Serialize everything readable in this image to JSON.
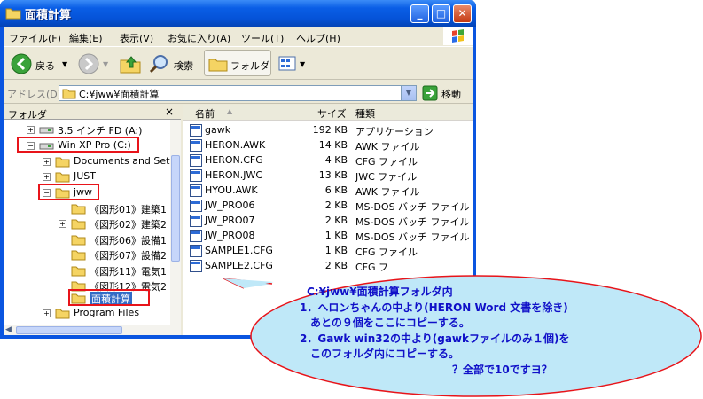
{
  "window": {
    "title": "面積計算",
    "controls": {
      "minimize": "_",
      "maximize": "□",
      "close": "✕"
    }
  },
  "menubar": [
    "ファイル(F)",
    "編集(E)",
    "表示(V)",
    "お気に入り(A)",
    "ツール(T)",
    "ヘルプ(H)"
  ],
  "toolbar": {
    "back": "戻る",
    "search": "検索",
    "folders": "フォルダ"
  },
  "address": {
    "label": "アドレス(D)",
    "value": "C:¥jww¥面積計算",
    "go": "移動"
  },
  "folder_pane": {
    "title": "フォルダ",
    "close": "×",
    "items": [
      {
        "label": "3.5 インチ FD (A:)",
        "expander": "+"
      },
      {
        "label": "Win XP Pro (C:)",
        "expander": "−"
      },
      {
        "label": "Documents and Sett",
        "expander": "+"
      },
      {
        "label": "JUST",
        "expander": "+"
      },
      {
        "label": "jww",
        "expander": "−"
      },
      {
        "label": "《図形01》建築1",
        "expander": ""
      },
      {
        "label": "《図形02》建築2",
        "expander": "+"
      },
      {
        "label": "《図形06》設備1",
        "expander": ""
      },
      {
        "label": "《図形07》設備2",
        "expander": ""
      },
      {
        "label": "《図形11》電気1",
        "expander": ""
      },
      {
        "label": "《図形12》電気2",
        "expander": ""
      },
      {
        "label": "面積計算",
        "expander": ""
      },
      {
        "label": "Program Files",
        "expander": "+"
      }
    ]
  },
  "file_list": {
    "columns": [
      "名前",
      "サイズ",
      "種類"
    ],
    "rows": [
      {
        "name": "gawk",
        "size": "192 KB",
        "type": "アプリケーション"
      },
      {
        "name": "HERON.AWK",
        "size": "14 KB",
        "type": "AWK ファイル"
      },
      {
        "name": "HERON.CFG",
        "size": "4 KB",
        "type": "CFG ファイル"
      },
      {
        "name": "HERON.JWC",
        "size": "13 KB",
        "type": "JWC ファイル"
      },
      {
        "name": "HYOU.AWK",
        "size": "6 KB",
        "type": "AWK ファイル"
      },
      {
        "name": "JW_PRO06",
        "size": "2 KB",
        "type": "MS-DOS バッチ ファイル"
      },
      {
        "name": "JW_PRO07",
        "size": "2 KB",
        "type": "MS-DOS バッチ ファイル"
      },
      {
        "name": "JW_PRO08",
        "size": "1 KB",
        "type": "MS-DOS バッチ ファイル"
      },
      {
        "name": "SAMPLE1.CFG",
        "size": "1 KB",
        "type": "CFG ファイル"
      },
      {
        "name": "SAMPLE2.CFG",
        "size": "2 KB",
        "type": "CFG フ"
      }
    ]
  },
  "callout": {
    "lines": [
      "C:¥jww¥面積計算フォルダ内",
      "1．ヘロンちゃんの中より(HERON Word 文書を除き)",
      "あとの９個をここにコピーする。",
      "2．Gawk win32の中より(gawkファイルのみ１個)を",
      "このフォルダ内にコピーする。",
      "？全部で10ですヨ？"
    ],
    "fill": "#bfe8f8",
    "border": "#e8141a"
  },
  "colors": {
    "title_blue": "#0a55e0",
    "highlight_red": "#e8141a",
    "callout_text": "#1010c8"
  }
}
